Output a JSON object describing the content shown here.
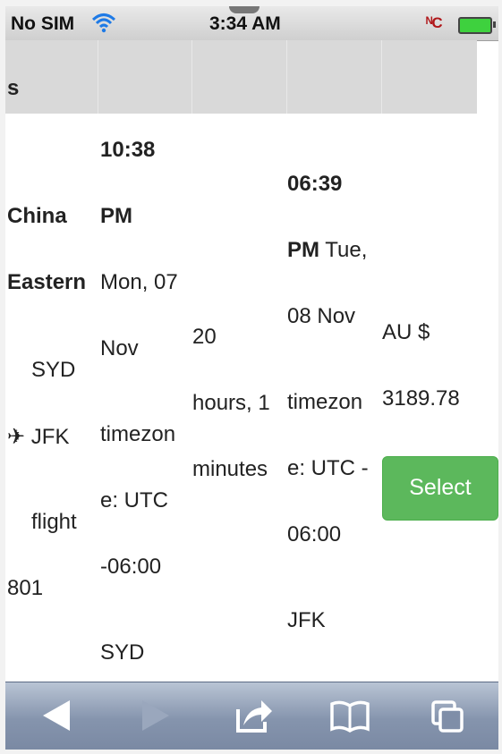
{
  "status_bar": {
    "carrier": "No SIM",
    "time": "3:34 AM",
    "wifi_icon": "wifi-icon",
    "battery_icon": "battery-charging-icon"
  },
  "table": {
    "header_text": "s"
  },
  "row": {
    "airline_line1": "China",
    "airline_line2": "Eastern",
    "route_from": "SYD",
    "route_to": "JFK",
    "flight_label": "flight",
    "flight_number": "801",
    "depart_time_line1": "10:38",
    "depart_time_line2": "PM",
    "depart_date_line1": "Mon, 07",
    "depart_date_line2": "Nov",
    "depart_tz_line1": "timezon",
    "depart_tz_line2": "e: UTC",
    "depart_tz_line3": "-06:00",
    "depart_airport": "SYD",
    "duration_line1": "20",
    "duration_line2": "hours, 1",
    "duration_line3": "minutes",
    "arrive_time": "06:39",
    "arrive_pm": "PM",
    "arrive_day": " Tue,",
    "arrive_date": "08 Nov",
    "arrive_tz_line1": "timezon",
    "arrive_tz_line2": "e: UTC -",
    "arrive_tz_line3": "06:00",
    "arrive_airport": "JFK",
    "price_currency": "AU $",
    "price_value": "3189.78",
    "select_label": "Select"
  },
  "toolbar": {
    "back_icon": "back-arrow-icon",
    "forward_icon": "forward-arrow-icon",
    "share_icon": "share-icon",
    "bookmarks_icon": "bookmarks-book-icon",
    "tabs_icon": "tabs-pages-icon"
  },
  "colors": {
    "select_button": "#5cb85c",
    "header_row": "#d9d9d9",
    "toolbar": "#8594ad"
  }
}
